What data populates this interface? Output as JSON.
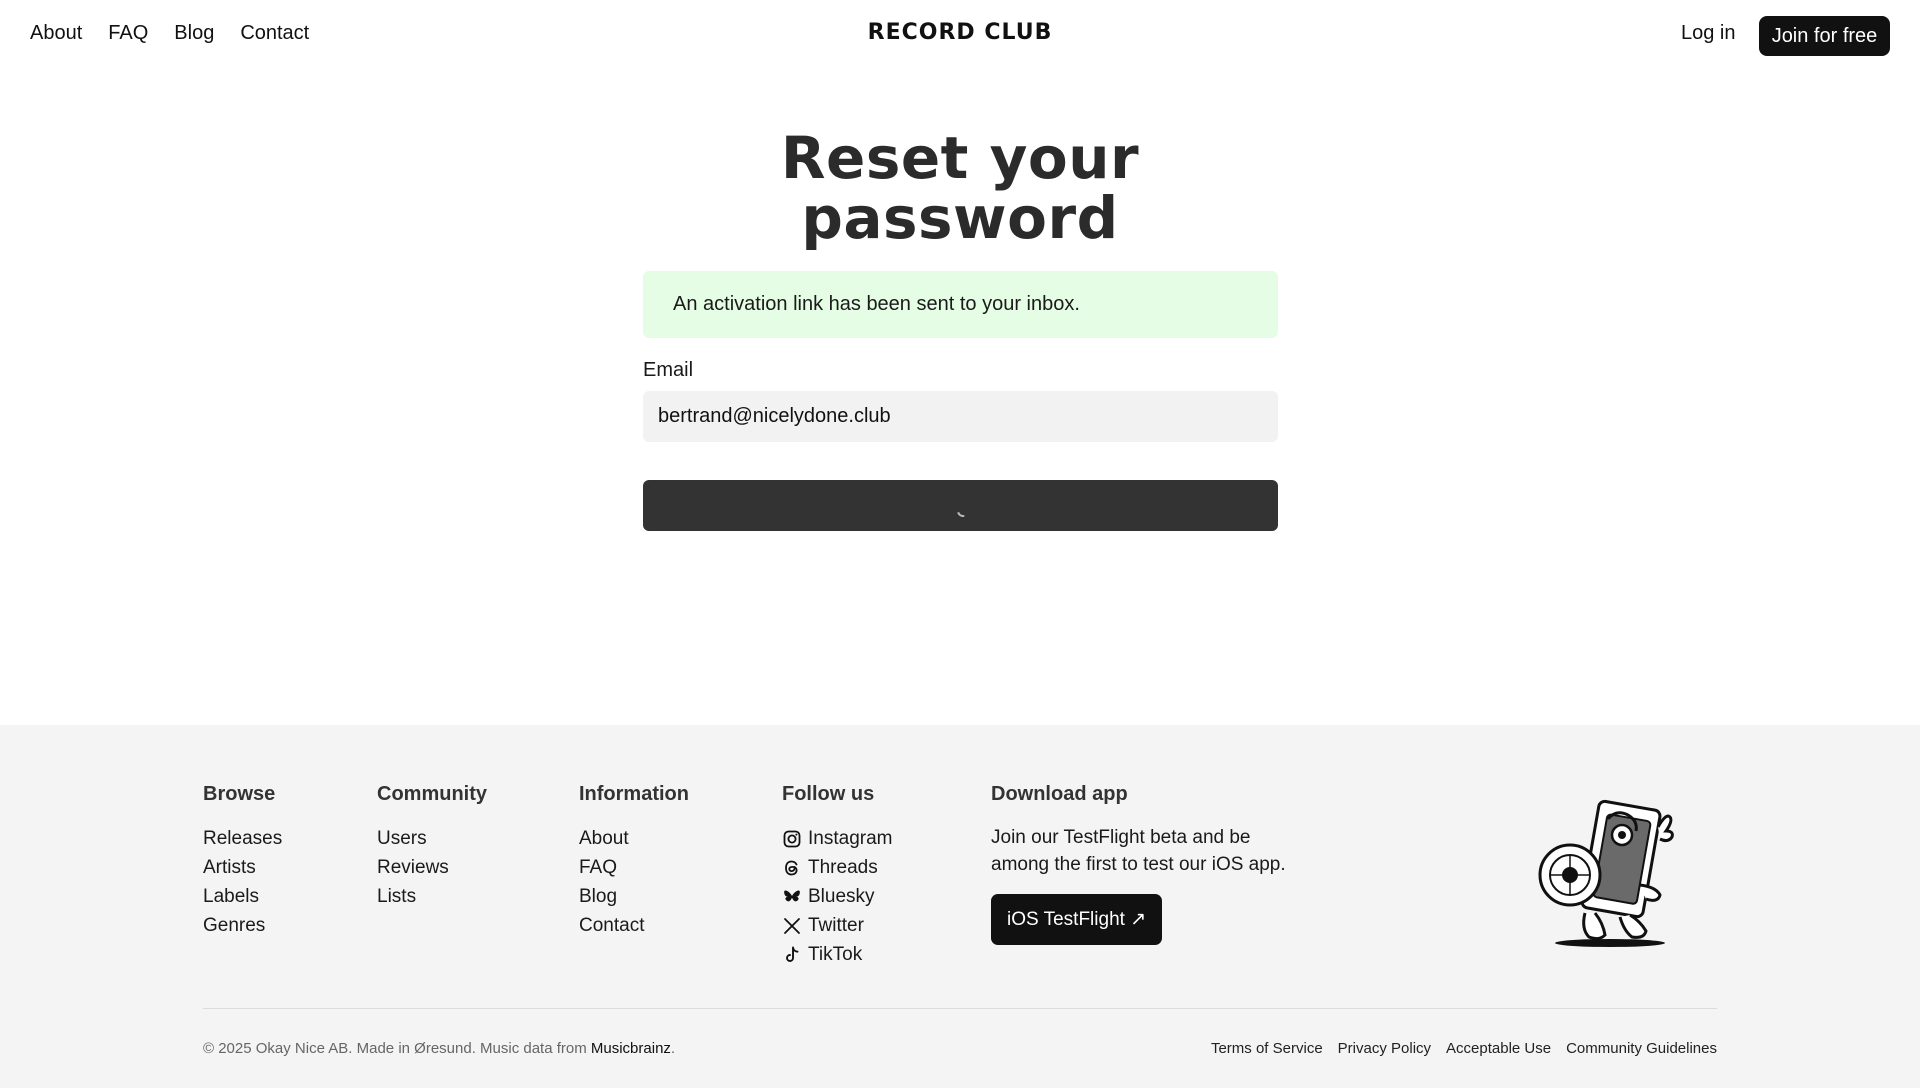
{
  "header": {
    "nav": [
      "About",
      "FAQ",
      "Blog",
      "Contact"
    ],
    "logo": "RECORD CLUB",
    "login": "Log in",
    "join": "Join for free"
  },
  "main": {
    "title_line1": "Reset your",
    "title_line2": "password",
    "notice": "An activation link has been sent to your inbox.",
    "email_label": "Email",
    "email_value": "bertrand@nicelydone.club"
  },
  "footer": {
    "browse": {
      "heading": "Browse",
      "items": [
        "Releases",
        "Artists",
        "Labels",
        "Genres"
      ]
    },
    "community": {
      "heading": "Community",
      "items": [
        "Users",
        "Reviews",
        "Lists"
      ]
    },
    "information": {
      "heading": "Information",
      "items": [
        "About",
        "FAQ",
        "Blog",
        "Contact"
      ]
    },
    "follow": {
      "heading": "Follow us",
      "items": [
        {
          "label": "Instagram",
          "icon": "instagram-icon"
        },
        {
          "label": "Threads",
          "icon": "threads-icon"
        },
        {
          "label": "Bluesky",
          "icon": "bluesky-icon"
        },
        {
          "label": "Twitter",
          "icon": "x-twitter-icon"
        },
        {
          "label": "TikTok",
          "icon": "tiktok-icon"
        }
      ]
    },
    "download": {
      "heading": "Download app",
      "text": "Join our TestFlight beta and be among the first to test our iOS app.",
      "button": "iOS TestFlight ↗"
    },
    "copyright_prefix": "© 2025 Okay Nice AB. Made in Øresund. Music data from ",
    "musicbrainz": "Musicbrainz",
    "copyright_suffix": ".",
    "legal": [
      "Terms of Service",
      "Privacy Policy",
      "Acceptable Use",
      "Community Guidelines"
    ]
  },
  "colors": {
    "notice_bg": "#e4fde4",
    "button_dark": "#111111",
    "submit_bg": "#333333",
    "footer_bg": "#f4f4f4"
  }
}
